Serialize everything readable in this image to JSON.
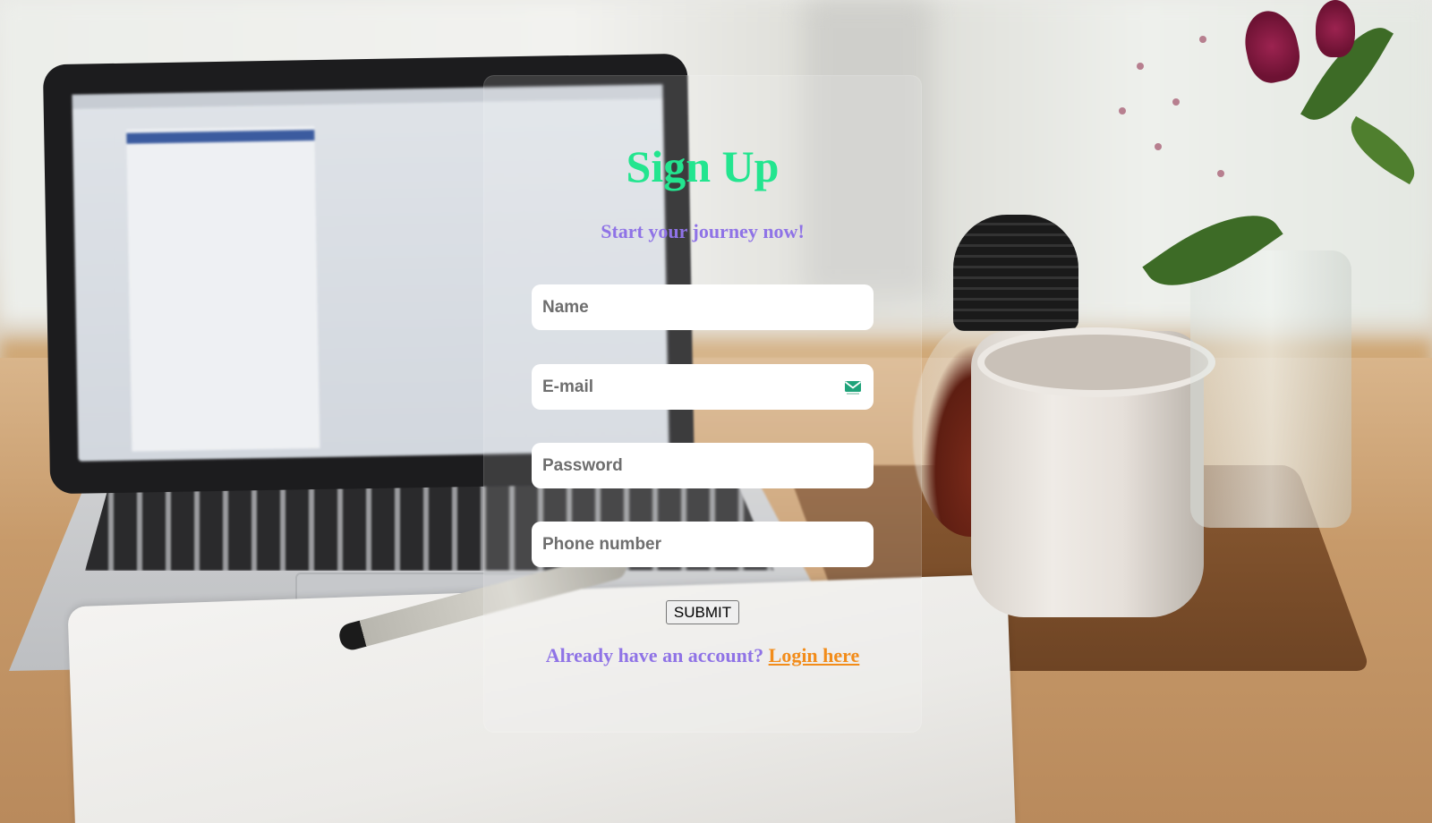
{
  "signup": {
    "title": "Sign Up",
    "subtitle": "Start your journey now!",
    "fields": {
      "name": {
        "placeholder": "Name",
        "value": ""
      },
      "email": {
        "placeholder": "E-mail",
        "value": ""
      },
      "password": {
        "placeholder": "Password",
        "value": ""
      },
      "phone": {
        "placeholder": "Phone number",
        "value": ""
      }
    },
    "email_icon": "envelope-icon",
    "submit_label": "SUBMIT",
    "footer_prompt": "Already have an account?",
    "login_link": "Login here"
  },
  "colors": {
    "title": "#23e58f",
    "subtitle": "#8f73e6",
    "link": "#f28c1a",
    "icon": "#1fa37a"
  },
  "background": "photo-laptop-notebook-mug-flowers"
}
